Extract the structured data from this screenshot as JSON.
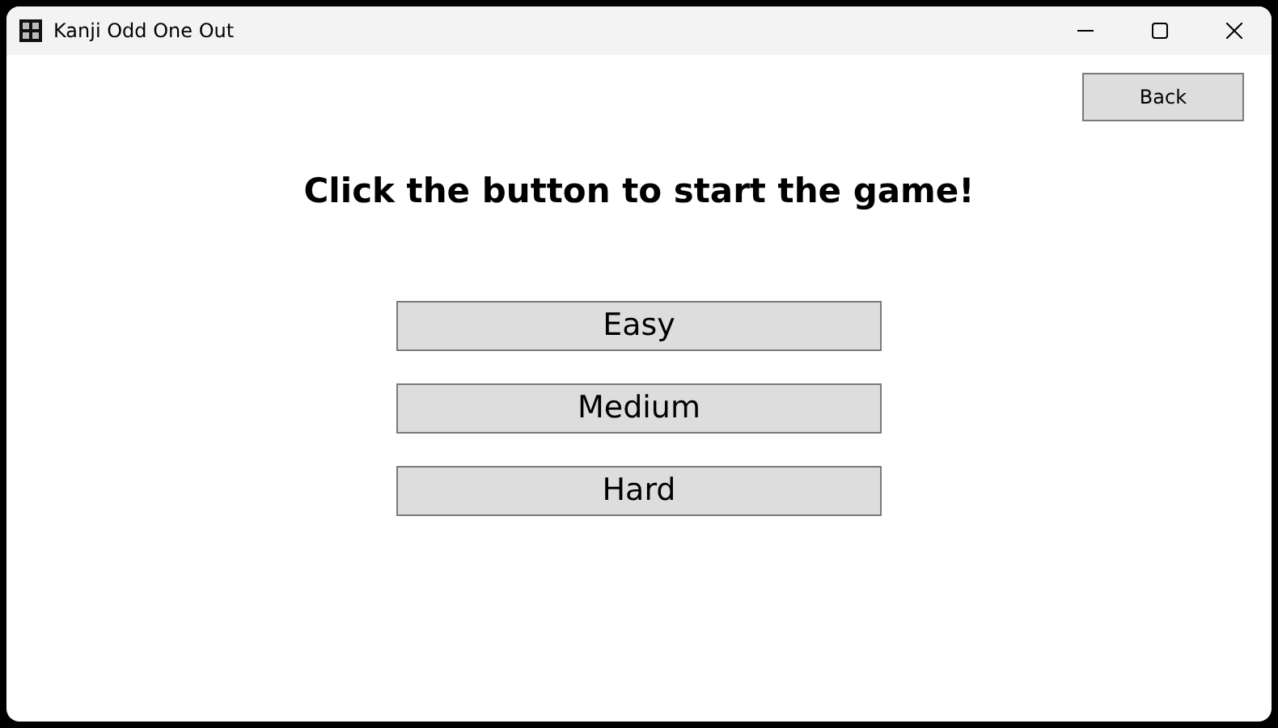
{
  "window": {
    "title": "Kanji Odd One Out"
  },
  "back_button": "Back",
  "heading": "Click the button to start the game!",
  "difficulty_buttons": [
    "Easy",
    "Medium",
    "Hard"
  ]
}
